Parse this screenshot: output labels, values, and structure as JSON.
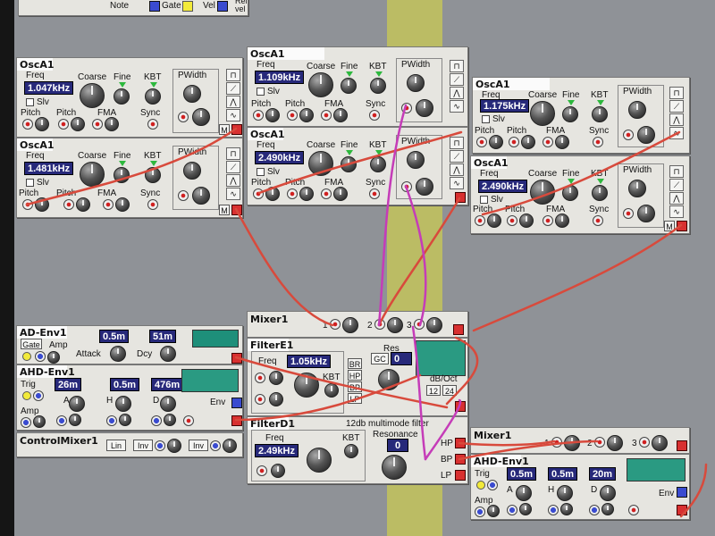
{
  "colors": {
    "background": "#8f9297",
    "module": "#e6e5e0",
    "display": "#27297a",
    "cable_red": "#d84a3c",
    "cable_magenta": "#c53cb8",
    "highlight_band": "#d7d746"
  },
  "top_strip": {
    "note": "Note",
    "gate": "Gate",
    "vel": "Vel",
    "rel": "Rel\nvel"
  },
  "osc_common": {
    "title": "OscA1",
    "freq": "Freq",
    "coarse": "Coarse",
    "fine": "Fine",
    "kbt": "KBT",
    "pwidth": "PWidth",
    "slv": "Slv",
    "pitch": "Pitch",
    "fma": "FMA",
    "sync": "Sync",
    "m": "M"
  },
  "osc_left_top": {
    "freq_value": "1.047kHz"
  },
  "osc_left_bottom": {
    "freq_value": "1.481kHz"
  },
  "osc_mid_top": {
    "freq_value": "1.109kHz"
  },
  "osc_mid_bottom": {
    "freq_value": "2.490kHz"
  },
  "osc_right_top": {
    "freq_value": "1.175kHz"
  },
  "osc_right_bottom": {
    "freq_value": "2.490kHz"
  },
  "ad_env": {
    "title": "AD-Env1",
    "gate": "Gate",
    "amp": "Amp",
    "attack_label": "Attack",
    "attack_value": "0.5m",
    "decay_label": "Dcy",
    "decay_value": "51m"
  },
  "ahd_env": {
    "title": "AHD-Env1",
    "trig": "Trig",
    "amp": "Amp",
    "a": "A",
    "h": "H",
    "d": "D",
    "env": "Env",
    "a_value": "26m",
    "h_value": "0.5m",
    "d_value": "476m"
  },
  "control_mixer": {
    "title": "ControlMixer1",
    "lin": "Lin",
    "inv1": "Inv",
    "inv2": "Inv"
  },
  "mixer_mid": {
    "title": "Mixer1",
    "in1": "1",
    "in2": "2",
    "in3": "3"
  },
  "filter_e": {
    "title": "FilterE1",
    "freq": "Freq",
    "freq_value": "1.05kHz",
    "kbt": "KBT",
    "res": "Res",
    "gc": "GC",
    "res_value": "0",
    "br": "BR",
    "hp": "HP",
    "bp": "BP",
    "lp": "LP",
    "db_oct": "dB/Oct",
    "s12": "12",
    "s24": "24"
  },
  "filter_d": {
    "title": "FilterD1",
    "subtitle": "12db multimode filter",
    "freq": "Freq",
    "freq_value": "2.49kHz",
    "kbt": "KBT",
    "resonance": "Resonance",
    "res_value": "0",
    "hp": "HP",
    "bp": "BP",
    "lp": "LP"
  },
  "mixer_right": {
    "title": "Mixer1",
    "in1": "1",
    "in2": "2",
    "in3": "3"
  },
  "ahd_env_right": {
    "title": "AHD-Env1",
    "trig": "Trig",
    "amp": "Amp",
    "a": "A",
    "h": "H",
    "d": "D",
    "env": "Env",
    "a_value": "0.5m",
    "h_value": "0.5m",
    "d_value": "20m"
  }
}
